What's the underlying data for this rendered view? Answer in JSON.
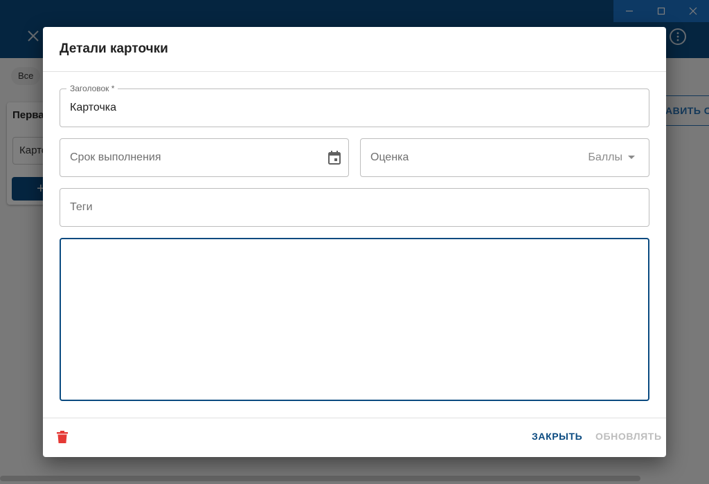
{
  "background": {
    "chip_label": "Все",
    "list_title": "Перва",
    "list_card_text": "Карто",
    "add_button_label": "+",
    "right_button_label": "АВИТЬ СП"
  },
  "dialog": {
    "title": "Детали карточки",
    "title_field": {
      "label": "Заголовок *",
      "value": "Карточка"
    },
    "due_field": {
      "placeholder": "Срок выполнения",
      "icon": "calendar-icon"
    },
    "rating_field": {
      "placeholder": "Оценка",
      "selected": "Баллы"
    },
    "tags_field": {
      "placeholder": "Теги"
    },
    "description": {
      "value": ""
    },
    "delete_icon": "trash-icon",
    "close_button": "ЗАКРЫТЬ",
    "update_button": "ОБНОВЛЯТЬ"
  },
  "colors": {
    "primary": "#0a4a80",
    "accent_blue": "#1a73c8",
    "danger": "#e53935",
    "disabled": "#bdbdbd"
  }
}
